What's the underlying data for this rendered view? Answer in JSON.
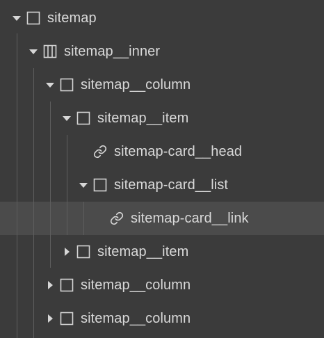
{
  "colors": {
    "background": "#3b3b3b",
    "selected_row": "#4b4b4b",
    "text": "#d9d9d9",
    "icon": "#d6d6d6",
    "guide_line": "#5e5e5e"
  },
  "tree": {
    "rows": [
      {
        "label": "sitemap",
        "icon": "square-icon",
        "state": "expanded",
        "selected": false
      },
      {
        "label": "sitemap__inner",
        "icon": "columns-layout-icon",
        "state": "expanded",
        "selected": false
      },
      {
        "label": "sitemap__column",
        "icon": "square-icon",
        "state": "expanded",
        "selected": false
      },
      {
        "label": "sitemap__item",
        "icon": "square-icon",
        "state": "expanded",
        "selected": false
      },
      {
        "label": "sitemap-card__head",
        "icon": "link-icon",
        "state": "leaf",
        "selected": false
      },
      {
        "label": "sitemap-card__list",
        "icon": "square-icon",
        "state": "expanded",
        "selected": false
      },
      {
        "label": "sitemap-card__link",
        "icon": "link-icon",
        "state": "leaf",
        "selected": true
      },
      {
        "label": "sitemap__item",
        "icon": "square-icon",
        "state": "collapsed",
        "selected": false
      },
      {
        "label": "sitemap__column",
        "icon": "square-icon",
        "state": "collapsed",
        "selected": false
      },
      {
        "label": "sitemap__column",
        "icon": "square-icon",
        "state": "collapsed",
        "selected": false
      }
    ]
  }
}
